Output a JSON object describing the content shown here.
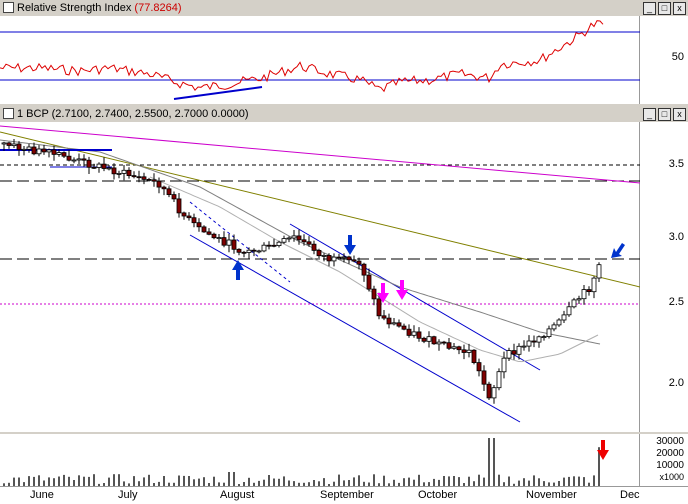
{
  "rsi_panel": {
    "title": "Relative Strength Index",
    "value": "(77.8264)",
    "y_tick": "50"
  },
  "price_panel": {
    "title": "1 BCP (2.7100, 2.7400, 2.5500, 2.7000 0.0000)",
    "y_ticks": [
      "3.5",
      "3.0",
      "2.5",
      "2.0"
    ]
  },
  "volume_panel": {
    "y_ticks": [
      "30000",
      "20000",
      "10000"
    ],
    "unit": "x1000"
  },
  "x_axis": {
    "months": [
      "June",
      "July",
      "August",
      "September",
      "October",
      "November",
      "Dec"
    ]
  },
  "window_buttons": {
    "minimize": "_",
    "restore": "□",
    "close": "x"
  },
  "colors": {
    "rsi_line": "#dd0000",
    "bull_candle": "#ffffff",
    "bear_candle": "#800000",
    "channel": "#0000cc",
    "magenta_line": "#cc00cc",
    "olive_line": "#808000",
    "blue_arrow": "#0033cc",
    "magenta_arrow": "#ff00ff",
    "red_arrow": "#ee0000"
  }
}
